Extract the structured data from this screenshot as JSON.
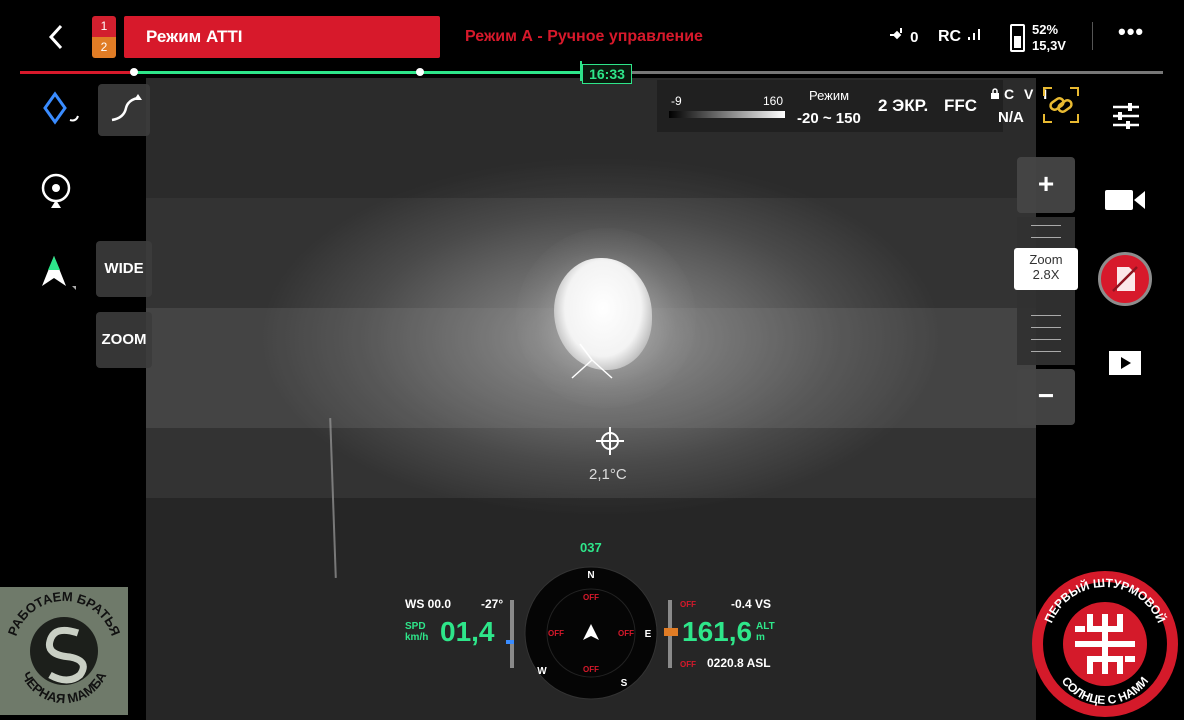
{
  "topbar": {
    "battery_1": "1",
    "battery_2": "2",
    "flight_mode": "Режим ATTI",
    "mode_subtitle": "Режим А - Ручное управление",
    "gps_count": "0",
    "rc_label": "RC",
    "battery_percent": "52%",
    "battery_voltage": "15,3V",
    "more_label": "•••"
  },
  "timeline": {
    "time": "16:33"
  },
  "left": {
    "wide_label": "WIDE",
    "zoom_label": "ZOOM"
  },
  "thermal": {
    "scale_low": "-9",
    "scale_high": "160",
    "mode_label": "Режим",
    "mode_range": "-20 ~ 150",
    "screens": "2 ЭКР.",
    "ffc": "FFC",
    "cvi": "C V I",
    "cvi_value": "N/A"
  },
  "zoom": {
    "plus": "+",
    "minus": "−",
    "label": "Zoom",
    "value": "2.8X"
  },
  "reticle": {
    "temperature": "2,1°C"
  },
  "telemetry": {
    "heading": "037",
    "ws": "WS 00.0",
    "ws_deg": "-27°",
    "spd_label_1": "SPD",
    "spd_label_2": "km/h",
    "speed": "01,4",
    "altitude": "161,6",
    "alt_label_1": "ALT",
    "alt_label_2": "m",
    "vs": "-0.4 VS",
    "asl": "0220.8 ASL",
    "off": "OFF"
  },
  "compass": {
    "n": "N",
    "e": "E",
    "s": "S",
    "w": "W"
  },
  "logos": {
    "left_text_top": "РАБОТАЕМ БРАТЬЯ",
    "left_text_bottom": "ЧЕРНАЯ МАМБА",
    "right_text_top": "ПЕРВЫЙ ШТУРМОВОЙ",
    "right_text_bottom": "СОЛНЦЕ С НАМИ"
  },
  "colors": {
    "accent_red": "#d7192b",
    "accent_green": "#2ee68a",
    "accent_orange": "#e07c25",
    "link_yellow": "#e8b931"
  }
}
